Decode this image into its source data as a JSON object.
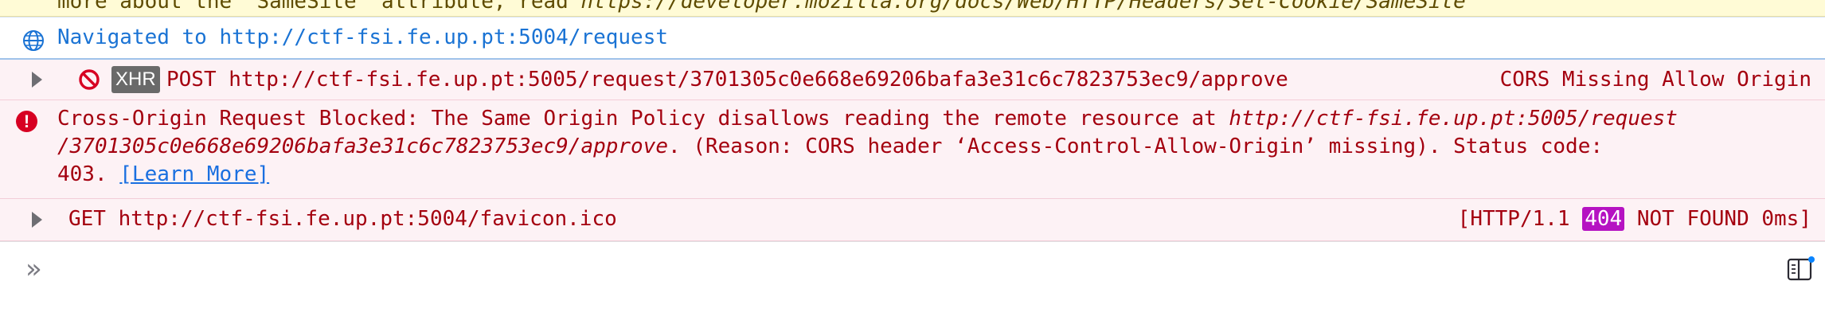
{
  "warning_row": {
    "text_before": "more about the \"SameSite\" attribute, read ",
    "url": "https://developer.mozilla.org/docs/Web/HTTP/Headers/Set-Cookie/SameSite"
  },
  "navigation": {
    "text": "Navigated to http://ctf-fsi.fe.up.pt:5004/request"
  },
  "request_1": {
    "badge": "XHR",
    "text": "POST http://ctf-fsi.fe.up.pt:5005/request/3701305c0e668e69206bafa3e31c6c7823753ec9/approve",
    "reason": "CORS Missing Allow Origin"
  },
  "blocked_error": {
    "prefix": "Cross-Origin Request Blocked: The Same Origin Policy disallows reading the remote resource at ",
    "url_line1": "http://ctf-fsi.fe.up.pt:5005/request",
    "url_line2": "/3701305c0e668e69206bafa3e31c6c7823753ec9/approve",
    "reason_text": ". (Reason: CORS header ‘Access-Control-Allow-Origin’ missing). Status code:",
    "status_code": "403.",
    "learn_more": "[Learn More]"
  },
  "request_2": {
    "text": "GET http://ctf-fsi.fe.up.pt:5004/favicon.ico",
    "status_prefix": "[HTTP/1.1",
    "status_code": "404",
    "status_suffix": "NOT FOUND 0ms]"
  },
  "console_input": {
    "prompt": "»",
    "value": ""
  },
  "colors": {
    "error_text": "#a4000f",
    "error_bg": "#fdf2f5",
    "link": "#1a6fe0",
    "navigation_text": "#1a73d4",
    "status_404_badge": "#b512c2"
  },
  "icons": [
    "globe-icon",
    "expand-arrow-icon",
    "blocked-icon",
    "error-icon",
    "sidebar-toggle-icon"
  ]
}
